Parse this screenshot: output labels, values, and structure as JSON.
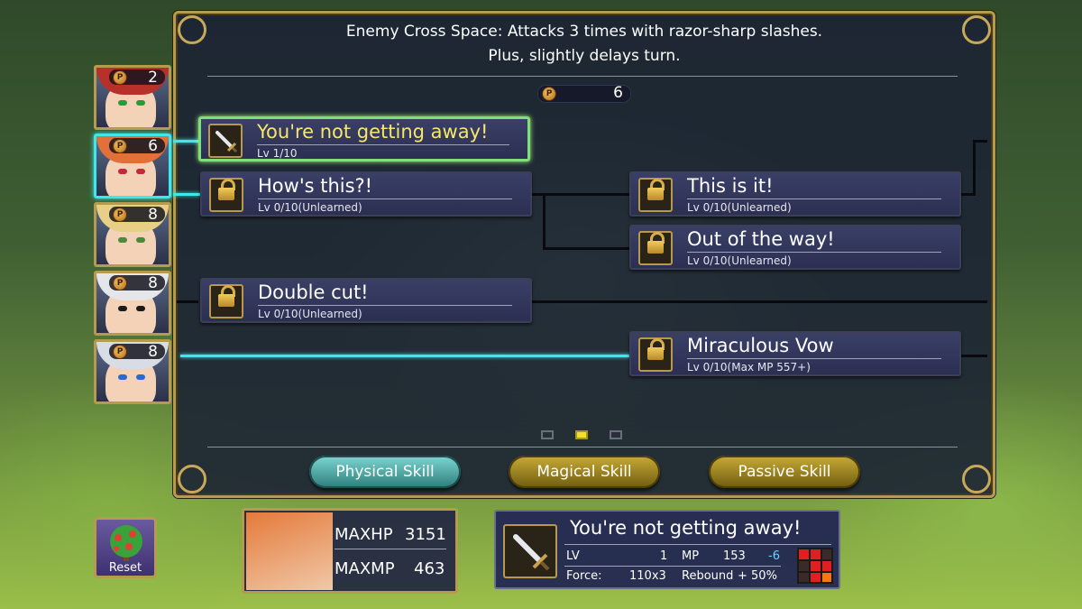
{
  "description": {
    "line1": "Enemy Cross Space: Attacks 3 times with razor-sharp slashes.",
    "line2": "Plus, slightly delays turn."
  },
  "skill_points": "6",
  "party": [
    {
      "points": "2",
      "hair": "#b8302a",
      "eye": "#2a9a3a",
      "active": false
    },
    {
      "points": "6",
      "hair": "#e1703a",
      "eye": "#c02a3a",
      "active": true
    },
    {
      "points": "8",
      "hair": "#e8cf86",
      "eye": "#4a8a3a",
      "active": false
    },
    {
      "points": "8",
      "hair": "#e4e6ea",
      "eye": "#1a1a1a",
      "active": false
    },
    {
      "points": "8",
      "hair": "#d8dce4",
      "eye": "#2a6ad0",
      "active": false
    }
  ],
  "skills": [
    {
      "name": "You're not getting away!",
      "level": "Lv 1/10",
      "icon": "sword-icon",
      "selected": true
    },
    {
      "name": "How's this?!",
      "level": "Lv 0/10(Unlearned)",
      "icon": "lock-icon"
    },
    {
      "name": "This is it!",
      "level": "Lv 0/10(Unlearned)",
      "icon": "lock-icon"
    },
    {
      "name": "Out of the way!",
      "level": "Lv 0/10(Unlearned)",
      "icon": "lock-icon"
    },
    {
      "name": "Double cut!",
      "level": "Lv 0/10(Unlearned)",
      "icon": "lock-icon"
    },
    {
      "name": "Miraculous Vow",
      "level": "Lv 0/10(Max MP 557+)",
      "icon": "lock-icon"
    }
  ],
  "pages": {
    "total": 3,
    "current": 2
  },
  "tabs": [
    {
      "label": "Physical Skill",
      "active": true
    },
    {
      "label": "Magical Skill",
      "active": false
    },
    {
      "label": "Passive Skill",
      "active": false
    }
  ],
  "reset_label": "Reset",
  "stats": {
    "maxhp_label": "MAXHP",
    "maxhp_value": "3151",
    "maxmp_label": "MAXMP",
    "maxmp_value": "463"
  },
  "detail": {
    "name": "You're not getting away!",
    "lv_label": "LV",
    "lv_value": "1",
    "mp_label": "MP",
    "mp_value": "153",
    "mp_delta": "-6",
    "force_label": "Force:",
    "force_value": "110x3",
    "rebound_label": "Rebound",
    "rebound_value": "+ 50%"
  },
  "colors": {
    "accent_cyan": "#3ee8ea",
    "selected_border": "#7ee07a",
    "gold_frame": "#b69a4e"
  }
}
